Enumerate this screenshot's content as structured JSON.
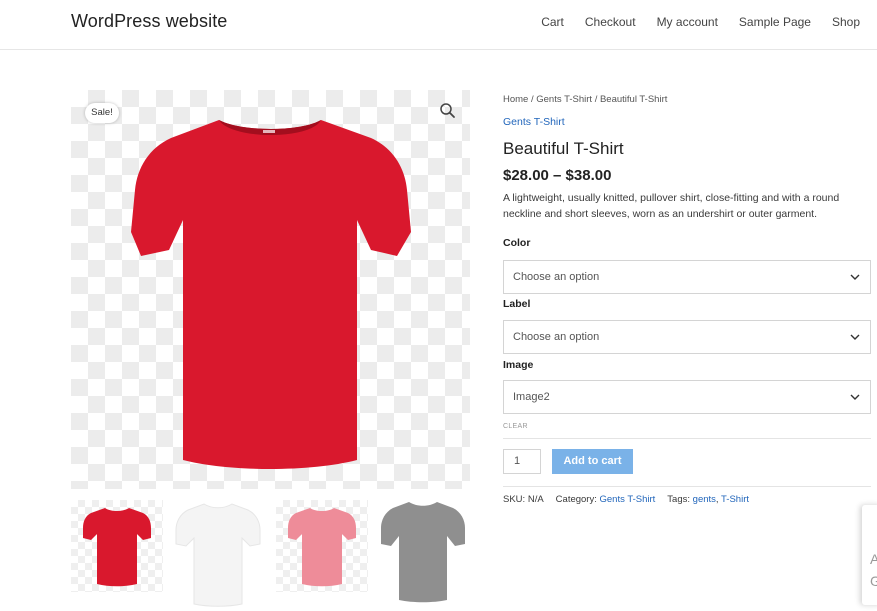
{
  "header": {
    "site_title": "WordPress website",
    "nav": [
      "Cart",
      "Checkout",
      "My account",
      "Sample Page",
      "Shop"
    ]
  },
  "gallery": {
    "sale_badge": "Sale!",
    "main_color": "#d9182d",
    "thumb_colors": [
      "#d9182d",
      "#f4f4f4",
      "#ee8c99",
      "#8f8f8f"
    ]
  },
  "product": {
    "breadcrumb": "Home / Gents T-Shirt / Beautiful T-Shirt",
    "category": "Gents T-Shirt",
    "title": "Beautiful T-Shirt",
    "price": "$28.00 – $38.00",
    "description": "A lightweight, usually knitted, pullover shirt, close-fitting and with a round neckline and short sleeves, worn as an undershirt or outer garment."
  },
  "variations": {
    "color_label": "Color",
    "color_value": "Choose an option",
    "label_label": "Label",
    "label_value": "Choose an option",
    "image_label": "Image",
    "image_value": "Image2",
    "clear": "CLEAR"
  },
  "cart": {
    "quantity": "1",
    "add_to_cart": "Add to cart"
  },
  "meta": {
    "sku_label": "SKU:",
    "sku": "N/A",
    "category_label": "Category:",
    "category": "Gents T-Shirt",
    "tags_label": "Tags:",
    "tag1": "gents",
    "tag2": "T-Shirt"
  },
  "edge_widget": {
    "text1": "A",
    "text2": "G"
  }
}
